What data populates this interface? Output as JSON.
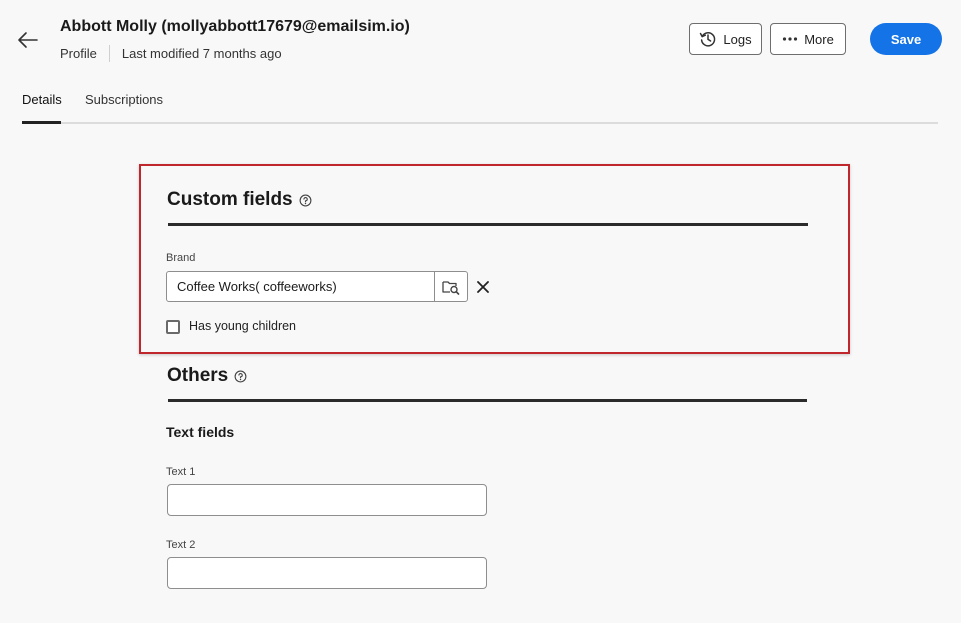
{
  "header": {
    "title": "Abbott Molly (mollyabbott17679@emailsim.io)",
    "breadcrumb": "Profile",
    "last_modified": "Last modified 7 months ago",
    "logs_label": "Logs",
    "more_label": "More",
    "save_label": "Save"
  },
  "tabs": [
    {
      "label": "Details",
      "active": true
    },
    {
      "label": "Subscriptions",
      "active": false
    }
  ],
  "custom_fields": {
    "title": "Custom fields",
    "brand_label": "Brand",
    "brand_value": "Coffee Works( coffeeworks)",
    "has_young_children_label": "Has young children",
    "has_young_children_checked": false
  },
  "others": {
    "title": "Others",
    "text_fields_title": "Text fields",
    "text1_label": "Text 1",
    "text1_value": "",
    "text2_label": "Text 2",
    "text2_value": ""
  },
  "colors": {
    "accent": "#1473e6",
    "highlight_border": "#c0272d"
  },
  "icons": {
    "back": "arrow-left-icon",
    "logs": "history-icon",
    "more": "ellipsis-icon",
    "help": "help-circle-icon",
    "picker": "folder-search-icon",
    "clear": "close-icon"
  }
}
